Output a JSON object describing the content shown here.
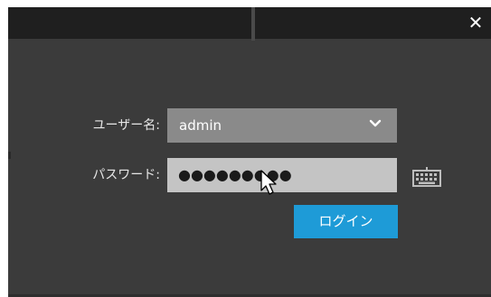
{
  "window": {
    "close_glyph": "✕"
  },
  "login_form": {
    "username_label": "ユーザー名:",
    "username_value": "admin",
    "password_label": "パスワード:",
    "password_masked": "●●●●●●●●●",
    "login_button_label": "ログイン"
  },
  "icons": {
    "close": "close-icon",
    "dropdown": "chevron-down-icon",
    "keyboard": "keyboard-icon",
    "cursor": "mouse-pointer-icon"
  },
  "colors": {
    "dialog_background": "#3b3b3b",
    "top_bar": "#1f1f1f",
    "select_background": "#8a8a8a",
    "password_background": "#c4c4c4",
    "accent_button": "#1e9bd7"
  }
}
